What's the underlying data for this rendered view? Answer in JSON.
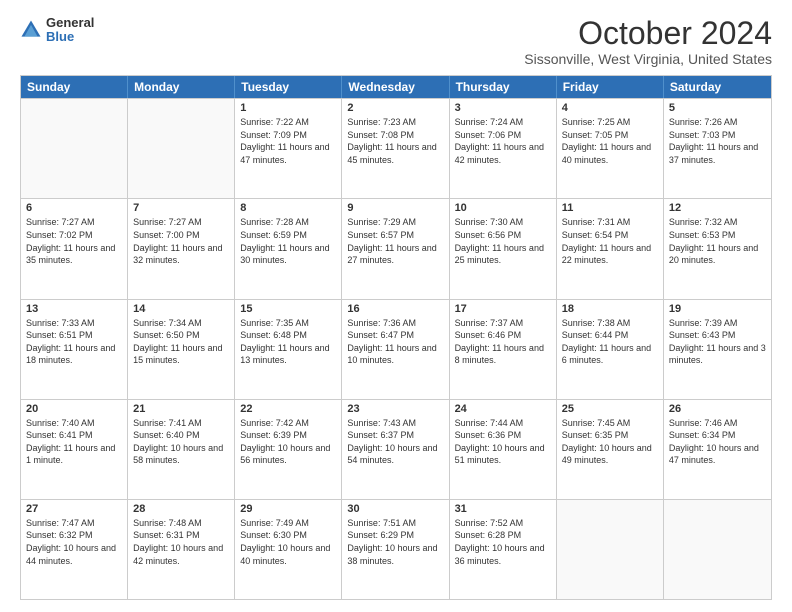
{
  "header": {
    "logo_general": "General",
    "logo_blue": "Blue",
    "title": "October 2024",
    "subtitle": "Sissonville, West Virginia, United States"
  },
  "days": [
    "Sunday",
    "Monday",
    "Tuesday",
    "Wednesday",
    "Thursday",
    "Friday",
    "Saturday"
  ],
  "weeks": [
    [
      {
        "day": "",
        "sunrise": "",
        "sunset": "",
        "daylight": "",
        "empty": true
      },
      {
        "day": "",
        "sunrise": "",
        "sunset": "",
        "daylight": "",
        "empty": true
      },
      {
        "day": "1",
        "sunrise": "Sunrise: 7:22 AM",
        "sunset": "Sunset: 7:09 PM",
        "daylight": "Daylight: 11 hours and 47 minutes."
      },
      {
        "day": "2",
        "sunrise": "Sunrise: 7:23 AM",
        "sunset": "Sunset: 7:08 PM",
        "daylight": "Daylight: 11 hours and 45 minutes."
      },
      {
        "day": "3",
        "sunrise": "Sunrise: 7:24 AM",
        "sunset": "Sunset: 7:06 PM",
        "daylight": "Daylight: 11 hours and 42 minutes."
      },
      {
        "day": "4",
        "sunrise": "Sunrise: 7:25 AM",
        "sunset": "Sunset: 7:05 PM",
        "daylight": "Daylight: 11 hours and 40 minutes."
      },
      {
        "day": "5",
        "sunrise": "Sunrise: 7:26 AM",
        "sunset": "Sunset: 7:03 PM",
        "daylight": "Daylight: 11 hours and 37 minutes."
      }
    ],
    [
      {
        "day": "6",
        "sunrise": "Sunrise: 7:27 AM",
        "sunset": "Sunset: 7:02 PM",
        "daylight": "Daylight: 11 hours and 35 minutes."
      },
      {
        "day": "7",
        "sunrise": "Sunrise: 7:27 AM",
        "sunset": "Sunset: 7:00 PM",
        "daylight": "Daylight: 11 hours and 32 minutes."
      },
      {
        "day": "8",
        "sunrise": "Sunrise: 7:28 AM",
        "sunset": "Sunset: 6:59 PM",
        "daylight": "Daylight: 11 hours and 30 minutes."
      },
      {
        "day": "9",
        "sunrise": "Sunrise: 7:29 AM",
        "sunset": "Sunset: 6:57 PM",
        "daylight": "Daylight: 11 hours and 27 minutes."
      },
      {
        "day": "10",
        "sunrise": "Sunrise: 7:30 AM",
        "sunset": "Sunset: 6:56 PM",
        "daylight": "Daylight: 11 hours and 25 minutes."
      },
      {
        "day": "11",
        "sunrise": "Sunrise: 7:31 AM",
        "sunset": "Sunset: 6:54 PM",
        "daylight": "Daylight: 11 hours and 22 minutes."
      },
      {
        "day": "12",
        "sunrise": "Sunrise: 7:32 AM",
        "sunset": "Sunset: 6:53 PM",
        "daylight": "Daylight: 11 hours and 20 minutes."
      }
    ],
    [
      {
        "day": "13",
        "sunrise": "Sunrise: 7:33 AM",
        "sunset": "Sunset: 6:51 PM",
        "daylight": "Daylight: 11 hours and 18 minutes."
      },
      {
        "day": "14",
        "sunrise": "Sunrise: 7:34 AM",
        "sunset": "Sunset: 6:50 PM",
        "daylight": "Daylight: 11 hours and 15 minutes."
      },
      {
        "day": "15",
        "sunrise": "Sunrise: 7:35 AM",
        "sunset": "Sunset: 6:48 PM",
        "daylight": "Daylight: 11 hours and 13 minutes."
      },
      {
        "day": "16",
        "sunrise": "Sunrise: 7:36 AM",
        "sunset": "Sunset: 6:47 PM",
        "daylight": "Daylight: 11 hours and 10 minutes."
      },
      {
        "day": "17",
        "sunrise": "Sunrise: 7:37 AM",
        "sunset": "Sunset: 6:46 PM",
        "daylight": "Daylight: 11 hours and 8 minutes."
      },
      {
        "day": "18",
        "sunrise": "Sunrise: 7:38 AM",
        "sunset": "Sunset: 6:44 PM",
        "daylight": "Daylight: 11 hours and 6 minutes."
      },
      {
        "day": "19",
        "sunrise": "Sunrise: 7:39 AM",
        "sunset": "Sunset: 6:43 PM",
        "daylight": "Daylight: 11 hours and 3 minutes."
      }
    ],
    [
      {
        "day": "20",
        "sunrise": "Sunrise: 7:40 AM",
        "sunset": "Sunset: 6:41 PM",
        "daylight": "Daylight: 11 hours and 1 minute."
      },
      {
        "day": "21",
        "sunrise": "Sunrise: 7:41 AM",
        "sunset": "Sunset: 6:40 PM",
        "daylight": "Daylight: 10 hours and 58 minutes."
      },
      {
        "day": "22",
        "sunrise": "Sunrise: 7:42 AM",
        "sunset": "Sunset: 6:39 PM",
        "daylight": "Daylight: 10 hours and 56 minutes."
      },
      {
        "day": "23",
        "sunrise": "Sunrise: 7:43 AM",
        "sunset": "Sunset: 6:37 PM",
        "daylight": "Daylight: 10 hours and 54 minutes."
      },
      {
        "day": "24",
        "sunrise": "Sunrise: 7:44 AM",
        "sunset": "Sunset: 6:36 PM",
        "daylight": "Daylight: 10 hours and 51 minutes."
      },
      {
        "day": "25",
        "sunrise": "Sunrise: 7:45 AM",
        "sunset": "Sunset: 6:35 PM",
        "daylight": "Daylight: 10 hours and 49 minutes."
      },
      {
        "day": "26",
        "sunrise": "Sunrise: 7:46 AM",
        "sunset": "Sunset: 6:34 PM",
        "daylight": "Daylight: 10 hours and 47 minutes."
      }
    ],
    [
      {
        "day": "27",
        "sunrise": "Sunrise: 7:47 AM",
        "sunset": "Sunset: 6:32 PM",
        "daylight": "Daylight: 10 hours and 44 minutes."
      },
      {
        "day": "28",
        "sunrise": "Sunrise: 7:48 AM",
        "sunset": "Sunset: 6:31 PM",
        "daylight": "Daylight: 10 hours and 42 minutes."
      },
      {
        "day": "29",
        "sunrise": "Sunrise: 7:49 AM",
        "sunset": "Sunset: 6:30 PM",
        "daylight": "Daylight: 10 hours and 40 minutes."
      },
      {
        "day": "30",
        "sunrise": "Sunrise: 7:51 AM",
        "sunset": "Sunset: 6:29 PM",
        "daylight": "Daylight: 10 hours and 38 minutes."
      },
      {
        "day": "31",
        "sunrise": "Sunrise: 7:52 AM",
        "sunset": "Sunset: 6:28 PM",
        "daylight": "Daylight: 10 hours and 36 minutes."
      },
      {
        "day": "",
        "sunrise": "",
        "sunset": "",
        "daylight": "",
        "empty": true
      },
      {
        "day": "",
        "sunrise": "",
        "sunset": "",
        "daylight": "",
        "empty": true
      }
    ]
  ]
}
